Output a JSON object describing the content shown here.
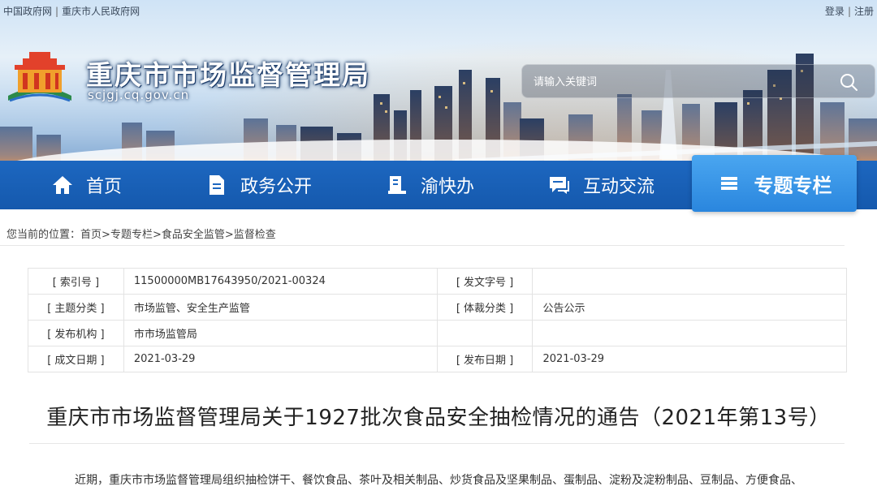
{
  "top_links": {
    "left": [
      "中国政府网",
      "重庆市人民政府网"
    ],
    "separator": "|",
    "right": [
      "登录",
      "注册"
    ]
  },
  "header": {
    "title": "重庆市市场监督管理局",
    "domain": "scjgj.cq.gov.cn",
    "logo_icon": "gov-emblem-logo"
  },
  "search": {
    "placeholder": "请输入关键词",
    "icon": "search-icon"
  },
  "nav": {
    "items": [
      {
        "label": "首页",
        "icon": "home-icon"
      },
      {
        "label": "政务公开",
        "icon": "document-icon"
      },
      {
        "label": "渝快办",
        "icon": "service-icon"
      },
      {
        "label": "互动交流",
        "icon": "chat-icon"
      },
      {
        "label": "专题专栏",
        "icon": "list-icon",
        "active": true
      }
    ]
  },
  "breadcrumb": {
    "prefix": "您当前的位置：",
    "items": [
      "首页",
      "专题专栏",
      "食品安全监管",
      "监督检查"
    ],
    "separator": ">"
  },
  "info": {
    "rows": [
      {
        "l1": "[ 索引号 ]",
        "v1": "11500000MB17643950/2021-00324",
        "l2": "[ 发文字号 ]",
        "v2": ""
      },
      {
        "l1": "[ 主题分类 ]",
        "v1": "市场监管、安全生产监管",
        "l2": "[ 体裁分类 ]",
        "v2": "公告公示"
      },
      {
        "l1": "[ 发布机构 ]",
        "v1": "市市场监管局",
        "l2": "",
        "v2": ""
      },
      {
        "l1": "[ 成文日期 ]",
        "v1": "2021-03-29",
        "l2": "[ 发布日期 ]",
        "v2": "2021-03-29"
      }
    ]
  },
  "article": {
    "title": "重庆市市场监督管理局关于1927批次食品安全抽检情况的通告（2021年第13号）",
    "body": "近期，重庆市市场监督管理局组织抽检饼干、餐饮食品、茶叶及相关制品、炒货食品及坚果制品、蛋制品、淀粉及淀粉制品、豆制品、方便食品、"
  },
  "colors": {
    "nav_bg": "#1559ad",
    "nav_active": "#2a86de",
    "text": "#333333"
  }
}
